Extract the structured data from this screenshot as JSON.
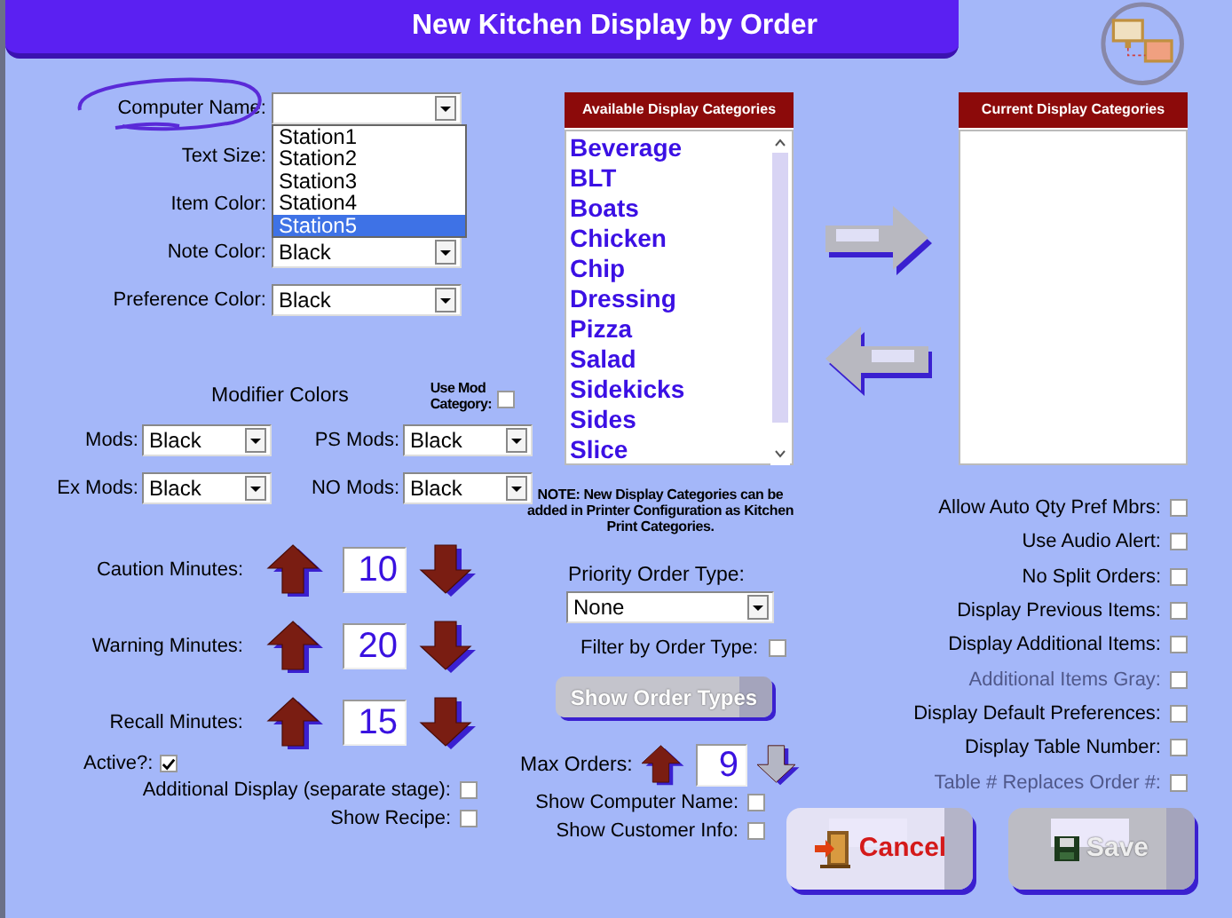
{
  "window": {
    "title": "New Kitchen Display by Order"
  },
  "computer_name": {
    "label": "Computer Name:",
    "expanded": true,
    "options": [
      {
        "label": "Station1",
        "selected": false
      },
      {
        "label": "Station2",
        "selected": false
      },
      {
        "label": "Station3",
        "selected": false
      },
      {
        "label": "Station4",
        "selected": false
      },
      {
        "label": "Station5",
        "selected": true
      }
    ]
  },
  "color_settings": [
    {
      "label": "Text Size:"
    },
    {
      "label": "Item Color:"
    },
    {
      "label": "Note Color:",
      "value": "Black"
    },
    {
      "label": "Preference Color:",
      "value": "Black"
    }
  ],
  "modifier_colors": {
    "title": "Modifier Colors",
    "use_mod_category": {
      "label": "Use Mod Category:",
      "checked": false
    },
    "fields": [
      {
        "label": "Mods:",
        "value": "Black"
      },
      {
        "label": "PS Mods:",
        "value": "Black"
      },
      {
        "label": "Ex Mods:",
        "value": "Black"
      },
      {
        "label": "NO Mods:",
        "value": "Black"
      }
    ]
  },
  "minutes": [
    {
      "label": "Caution Minutes:",
      "value": "10"
    },
    {
      "label": "Warning Minutes:",
      "value": "20"
    },
    {
      "label": "Recall Minutes:",
      "value": "15"
    }
  ],
  "active": {
    "label": "Active?:",
    "checked": true
  },
  "display_options": [
    {
      "label": "Additional Display (separate stage):",
      "checked": false
    },
    {
      "label": "Show Recipe:",
      "checked": false
    }
  ],
  "available_categories": {
    "title": "Available Display Categories",
    "items": [
      "Beverage",
      "BLT",
      "Boats",
      "Chicken",
      "Chip",
      "Dressing",
      "Pizza",
      "Salad",
      "Sidekicks",
      "Sides",
      "Slice"
    ]
  },
  "current_categories": {
    "title": "Current Display Categories"
  },
  "note": "NOTE: New Display Categories can be added in Printer Configuration as Kitchen Print Categories.",
  "priority_order_type": {
    "label": "Priority Order Type:",
    "value": "None"
  },
  "filter_by_order_type": {
    "label": "Filter by Order Type:",
    "checked": false
  },
  "show_order_types": {
    "label": "Show Order Types",
    "disabled": true
  },
  "max_orders": {
    "label": "Max Orders:",
    "value": "9",
    "down_disabled": true
  },
  "order_options": [
    {
      "label": "Show Computer Name:",
      "checked": false
    },
    {
      "label": "Show Customer Info:",
      "checked": false
    }
  ],
  "preferences": [
    {
      "label": "Allow Auto Qty Pref Mbrs:",
      "checked": false,
      "disabled": false
    },
    {
      "label": "Use Audio Alert:",
      "checked": false,
      "disabled": false
    },
    {
      "label": "No Split Orders:",
      "checked": false,
      "disabled": false
    },
    {
      "label": "Display Previous Items:",
      "checked": false,
      "disabled": false
    },
    {
      "label": "Display Additional Items:",
      "checked": false,
      "disabled": false
    },
    {
      "label": "Additional Items Gray:",
      "checked": false,
      "disabled": true
    },
    {
      "label": "Display Default Preferences:",
      "checked": false,
      "disabled": false
    },
    {
      "label": "Display Table Number:",
      "checked": false,
      "disabled": false
    },
    {
      "label": "Table # Replaces Order #:",
      "checked": false,
      "disabled": true
    }
  ],
  "buttons": [
    {
      "kind": "cancel",
      "label": "Cancel",
      "disabled": false
    },
    {
      "kind": "save",
      "label": "Save",
      "disabled": true
    }
  ]
}
